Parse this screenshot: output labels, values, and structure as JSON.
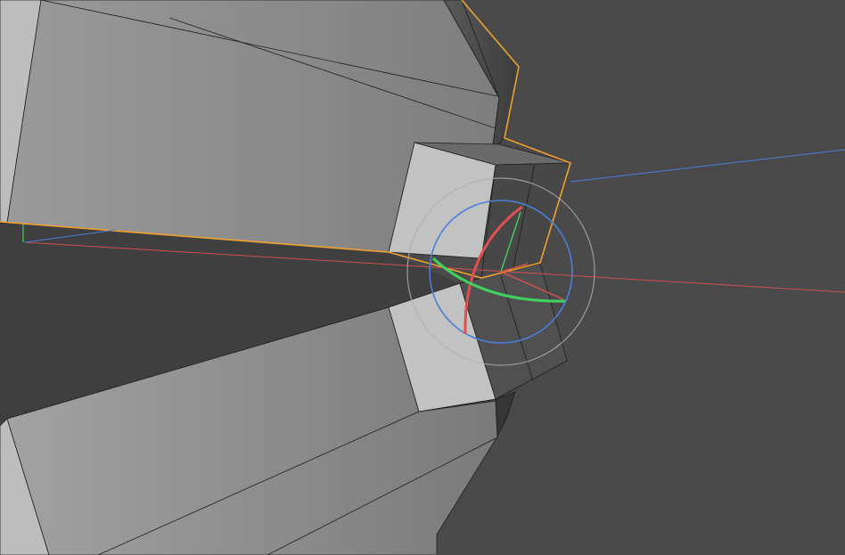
{
  "viewport": {
    "background_color": "#4a4a4a",
    "selection_color": "#f0a030",
    "axis_colors": {
      "x": "#e05050",
      "y": "#40d060",
      "z": "#4a7fd8"
    },
    "rotate_ring_color": "#b0b0b0",
    "icons": [
      "rotate-gizmo-icon",
      "world-axis-icon"
    ]
  }
}
